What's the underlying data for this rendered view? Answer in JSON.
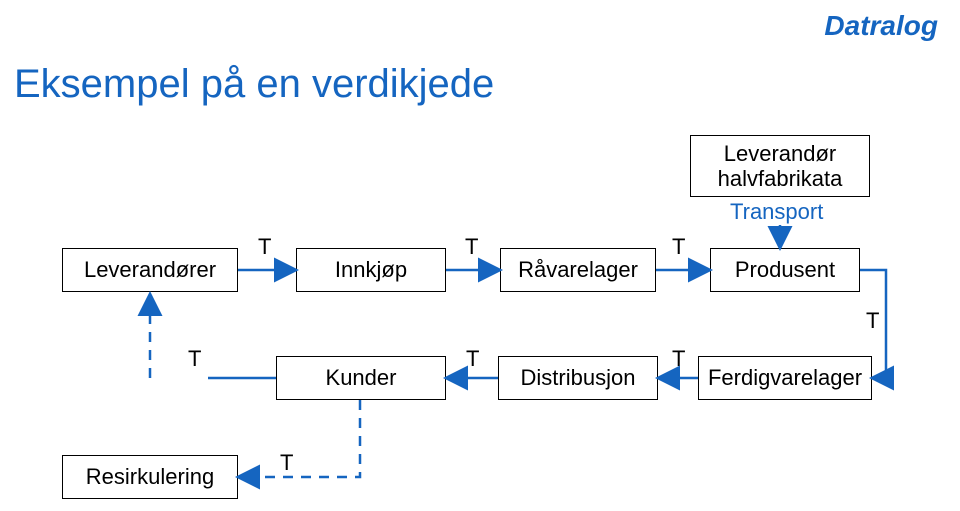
{
  "brand": "Datralog",
  "title": "Eksempel på en verdikjede",
  "boxes": {
    "leverandor_halvfabrikata": "Leverandør halvfabrikata",
    "leverandorer": "Leverandører",
    "innkjop": "Innkjøp",
    "ravarelager": "Råvarelager",
    "produsent": "Produsent",
    "kunder": "Kunder",
    "distribusjon": "Distribusjon",
    "ferdigvarelager": "Ferdigvarelager",
    "resirkulering": "Resirkulering"
  },
  "labels": {
    "transport": "Transport",
    "t": "T"
  },
  "colors": {
    "accent": "#1565c0",
    "text": "#000000"
  }
}
